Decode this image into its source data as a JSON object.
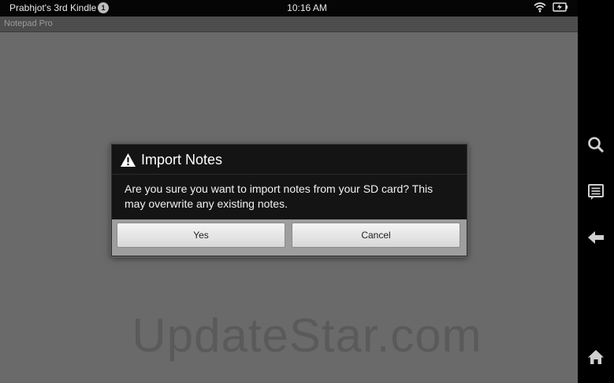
{
  "status_bar": {
    "device_name": "Prabhjot's 3rd Kindle",
    "notification_count": "1",
    "time": "10:16 AM",
    "icons": [
      "wifi-icon",
      "battery-icon"
    ]
  },
  "app_bar": {
    "title": "Notepad Pro"
  },
  "dialog": {
    "title": "Import Notes",
    "icon": "warning-icon",
    "message": "Are you sure you want to import notes from your SD card? This may overwrite any existing notes.",
    "buttons": {
      "yes": "Yes",
      "cancel": "Cancel"
    }
  },
  "nav_bar": {
    "icons": [
      "search-icon",
      "menu-icon",
      "back-icon",
      "home-icon"
    ]
  },
  "watermark": "UpdateStar.com"
}
